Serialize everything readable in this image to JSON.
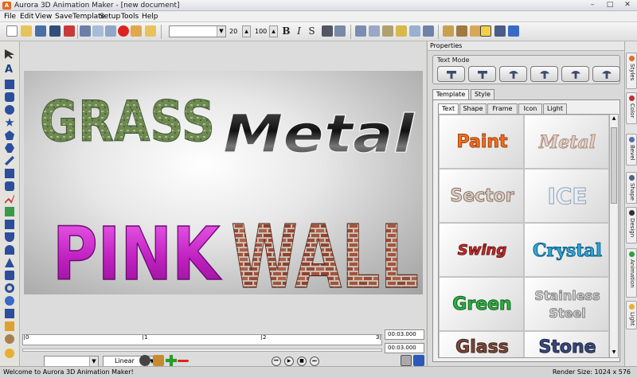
{
  "window": {
    "title": "Aurora 3D Animation Maker - [new document]",
    "app_icon_letter": "A"
  },
  "menu": [
    "File",
    "Edit",
    "View",
    "SaveTemplate",
    "Setup",
    "Tools",
    "Help"
  ],
  "toolbar": {
    "font_size": "20",
    "zoom": "100",
    "bold": "B",
    "italic": "I",
    "strike": "S"
  },
  "canvas": {
    "words": [
      "GRASS",
      "Metal",
      "PINK",
      "WALL"
    ]
  },
  "timeline": {
    "ticks": [
      "0",
      "1",
      "2",
      "3"
    ],
    "time_current": "00:03.000",
    "time_total": "00:03.000",
    "easing": "Linear"
  },
  "properties": {
    "title": "Properties",
    "text_mode_label": "Text Mode",
    "tabs": [
      "Template",
      "Style"
    ],
    "subtabs": [
      "Text",
      "Shape",
      "Frame",
      "Icon",
      "Light"
    ],
    "templates": [
      "Paint",
      "Metal",
      "Sector",
      "ICE",
      "Swing",
      "Crystal",
      "Green",
      "Stainless Steel",
      "Glass",
      "Stone"
    ]
  },
  "side_tabs": [
    "Styles",
    "Color",
    "Bevel",
    "Shape",
    "Design",
    "Animation",
    "Light"
  ],
  "status": {
    "left": "Welcome to Aurora 3D Animation Maker!",
    "right": "Render Size: 1024 x 576"
  },
  "colors": {
    "accent": "#e06a1a",
    "pink": "#d230d6",
    "grass": "#6e8a52"
  }
}
